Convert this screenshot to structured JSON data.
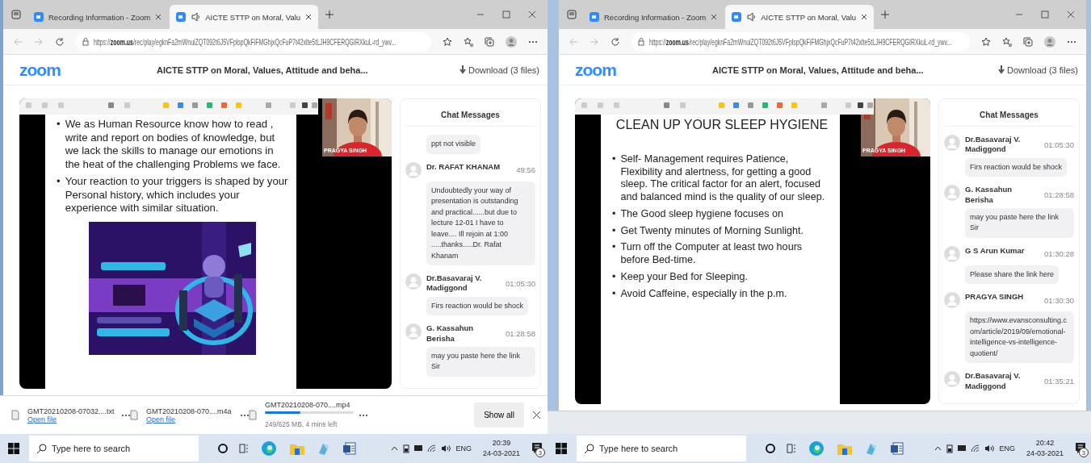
{
  "screens": [
    {
      "tabs": [
        {
          "title": "Recording Information - Zoom",
          "selected": false,
          "audio": false
        },
        {
          "title": "AICTE STTP on Moral, Valu",
          "selected": true,
          "audio": true
        }
      ],
      "url": {
        "scheme": "https://",
        "host": "zoom.us",
        "path": "/rec/play/egknFa2mWnuiZQT092t6J5VFplspQkFiFMGhjxQcFuP7t42xlte5tLJH9CFERQGIRXkuL-rd_ywv..."
      },
      "header": {
        "logo": "zoom",
        "title": "AICTE STTP on Moral, Values, Attitude and beha...",
        "download": "Download (3 files)"
      },
      "slide": {
        "marker": "•",
        "bullets": [
          "We as Human Resource know how to read , write  and report on bodies of knowledge, but we lack the skills to manage our emotions in the heat of the challenging Problems we face.",
          "Your reaction to your triggers is shaped by your Personal history, which includes your experience with similar situation."
        ],
        "figure": {
          "kind": "picture"
        }
      },
      "video": {
        "name": "PRAGYA SINGH"
      },
      "chat": {
        "title": "Chat Messages",
        "messages": [
          {
            "text": "ppt not visible"
          },
          {
            "sender": "Dr. RAFAT KHANAM",
            "time": "49:56",
            "text": "Undoubtedly your way of presentation is outstanding and practical......but due to lecture 12-01 I have to leave.... Ill rejoin at 1:00 .....thanks.....Dr. Rafat Khanam"
          },
          {
            "sender": "Dr.Basavaraj V. Madiggond",
            "time": "01:05:30",
            "text": "Firs reaction would be shock"
          },
          {
            "sender": "G. Kassahun Berisha",
            "time": "01:28:58",
            "text": "may you paste here the link Sir"
          }
        ]
      },
      "downloads": {
        "items": [
          {
            "kind": "complete",
            "name": "GMT20210208-07032....txt",
            "link": "Open file"
          },
          {
            "kind": "complete",
            "name": "GMT20210208-070....m4a",
            "link": "Open file"
          },
          {
            "kind": "progress",
            "name": "GMT20210208-070....mp4",
            "status": "249/625 MB, 4 mins left",
            "level": 0.4
          }
        ],
        "show_all": "Show all"
      },
      "taskbar": {
        "search_placeholder": "Type here to search",
        "language": "ENG",
        "time": "20:39",
        "date": "24-03-2021",
        "notifications": "3"
      }
    },
    {
      "tabs": [
        {
          "title": "Recording Information - Zoom",
          "selected": false,
          "audio": false
        },
        {
          "title": "AICTE STTP on Moral, Valu",
          "selected": true,
          "audio": true
        }
      ],
      "url": {
        "scheme": "https://",
        "host": "zoom.us",
        "path": "/rec/play/egknFa2mWnuiZQT092t6J5VFplspQkFiFMGhjxQcFuP7t42xlte5tLJH9CFERQGIRXkuL-rd_ywv..."
      },
      "header": {
        "logo": "zoom",
        "title": "AICTE STTP on Moral, Values, Attitude and beha...",
        "download": "Download (3 files)"
      },
      "slide": {
        "title": "CLEAN UP YOUR SLEEP HYGIENE",
        "marker": "•",
        "bullets": [
          "Self- Management requires Patience, Flexibility and alertness, for getting a good sleep. The critical factor for an alert, focused and balanced mind is the quality of our sleep.",
          "The Good sleep hygiene focuses on",
          "Get Twenty minutes of Morning Sunlight.",
          "Turn off the Computer at least two hours before Bed-time.",
          "Keep your Bed for Sleeping.",
          "Avoid Caffeine, especially in the p.m."
        ]
      },
      "video": {
        "name": "PRAGYA SINGH"
      },
      "chat": {
        "title": "Chat Messages",
        "messages": [
          {
            "sender": "Dr.Basavaraj V. Madiggond",
            "time": "01:05:30",
            "text": "Firs reaction would be shock"
          },
          {
            "sender": "G. Kassahun Berisha",
            "time": "01:28:58",
            "text": "may you paste here the link Sir"
          },
          {
            "sender": "G S Arun Kumar",
            "time": "01:30:28",
            "text": "Please share the link here"
          },
          {
            "sender": "PRAGYA SINGH",
            "time": "01:30:30",
            "text": "https://www.evansconsulting.com/article/2019/09/emotional-intelligence-vs-intelligence-quotient/"
          },
          {
            "sender": "Dr.Basavaraj V. Madiggond",
            "time": "01:35:21"
          }
        ]
      },
      "taskbar": {
        "search_placeholder": "Type here to search",
        "language": "ENG",
        "time": "20:42",
        "date": "24-03-2021",
        "notifications": "3"
      }
    }
  ]
}
